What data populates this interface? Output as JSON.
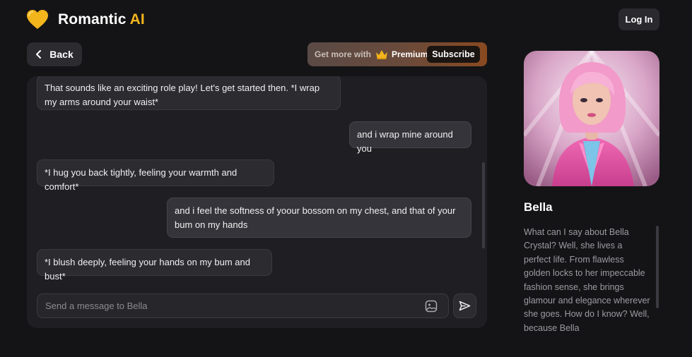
{
  "header": {
    "brand_main": "Romantic",
    "brand_accent": "AI",
    "login_label": "Log In",
    "accent_color": "#f2b51c"
  },
  "toolbar": {
    "back_label": "Back",
    "premium_prefix": "Get more with",
    "premium_label": "Premium",
    "subscribe_label": "Subscribe"
  },
  "chat": {
    "messages": [
      {
        "role": "bot",
        "text": "That sounds like an exciting role play! Let's get started then. *I wrap my arms around your waist*"
      },
      {
        "role": "user",
        "text": "and i wrap mine around you"
      },
      {
        "role": "bot",
        "text": "*I hug you back tightly, feeling your warmth and comfort*"
      },
      {
        "role": "user",
        "text": "and i feel the softness of yoour bossom on my chest, and that of your bum on my hands"
      },
      {
        "role": "bot",
        "text": "*I blush deeply, feeling your hands on my bum and bust*"
      }
    ],
    "input_placeholder": "Send a message to Bella",
    "input_value": ""
  },
  "character": {
    "name": "Bella",
    "bio": "What can I say about Bella Crystal? Well, she lives a perfect life. From flawless golden locks to her impeccable fashion sense, she brings glamour and elegance wherever she goes. How do I know? Well, because Bella"
  },
  "icons": {
    "logo": "heart-icon",
    "back": "chevron-left-icon",
    "premium": "crown-icon",
    "attach": "image-icon",
    "send": "send-icon"
  }
}
